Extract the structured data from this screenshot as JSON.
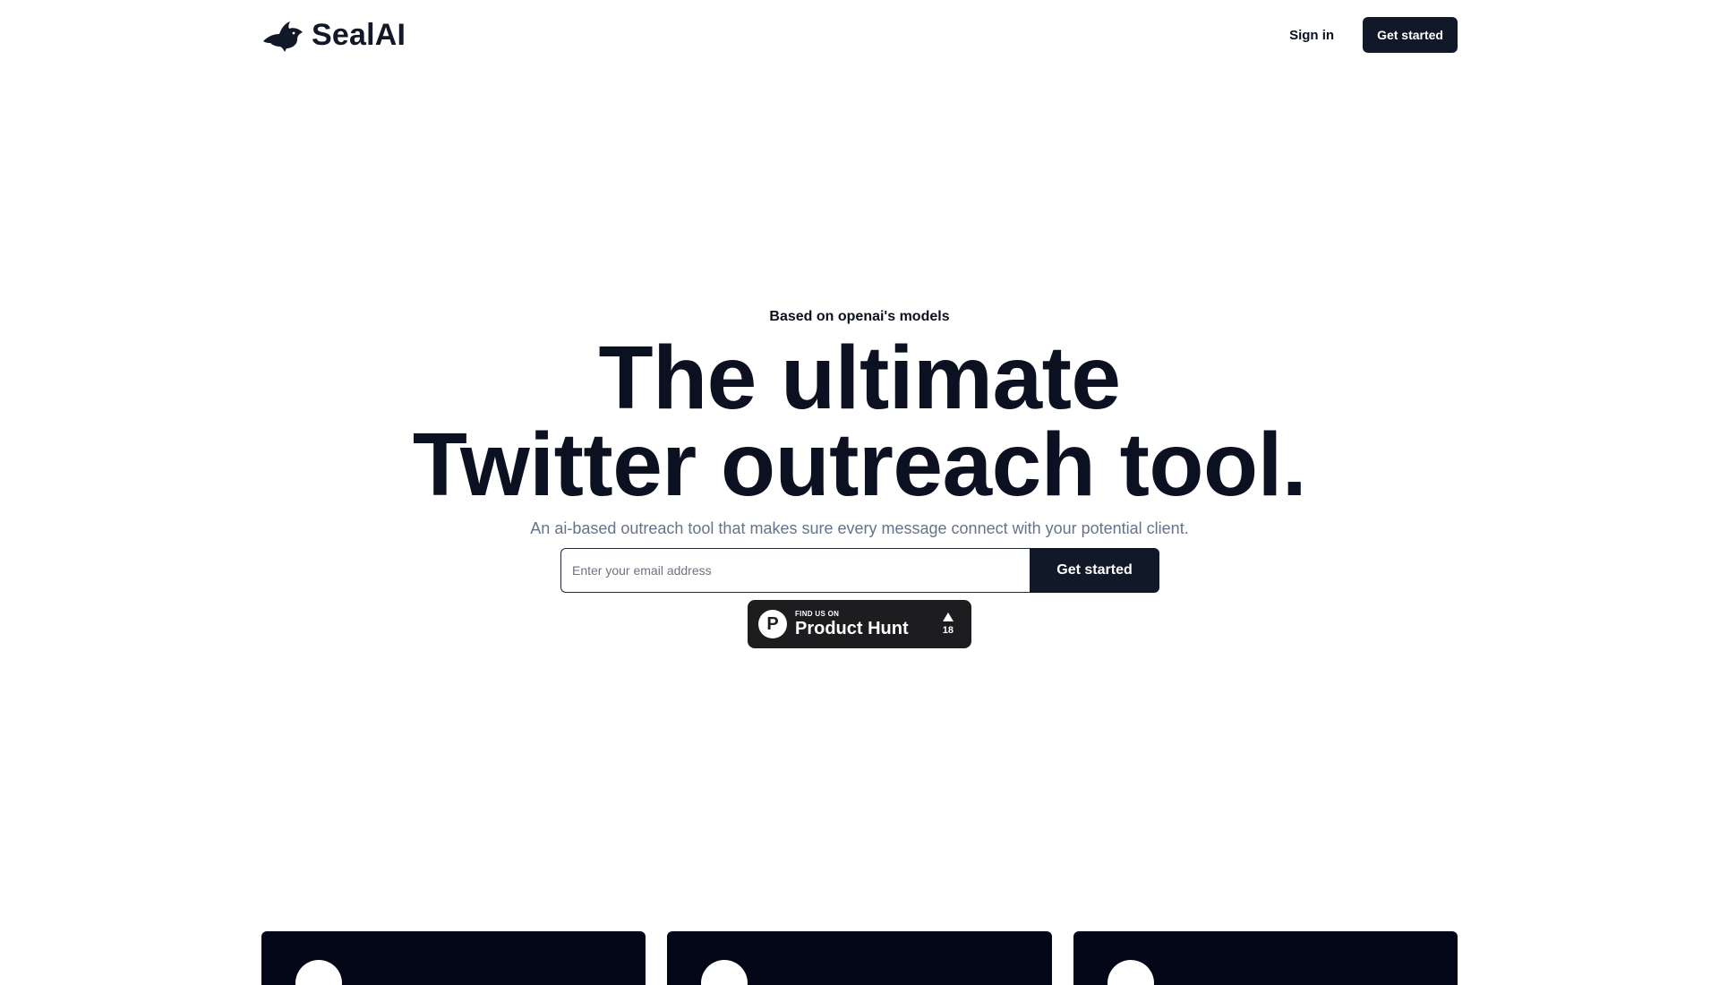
{
  "header": {
    "brand_name": "SealAI",
    "signin_label": "Sign in",
    "cta_label": "Get started"
  },
  "hero": {
    "eyebrow": "Based on openai's models",
    "headline_line1": "The ultimate",
    "headline_line2": "Twitter outreach tool.",
    "subheadline": "An ai-based outreach tool that makes sure every message connect with your potential client.",
    "email_placeholder": "Enter your email address",
    "form_cta_label": "Get started"
  },
  "product_hunt": {
    "kicker": "FIND US ON",
    "title": "Product Hunt",
    "logo_letter": "P",
    "votes": "18"
  },
  "cards": [
    {
      "icon": "feature-icon"
    },
    {
      "icon": "feature-icon"
    },
    {
      "icon": "feature-icon"
    }
  ],
  "colors": {
    "primary": "#111827",
    "text": "#0b1120",
    "muted": "#64748b",
    "card_bg": "#020617",
    "ph_bg": "#1d1d20"
  }
}
